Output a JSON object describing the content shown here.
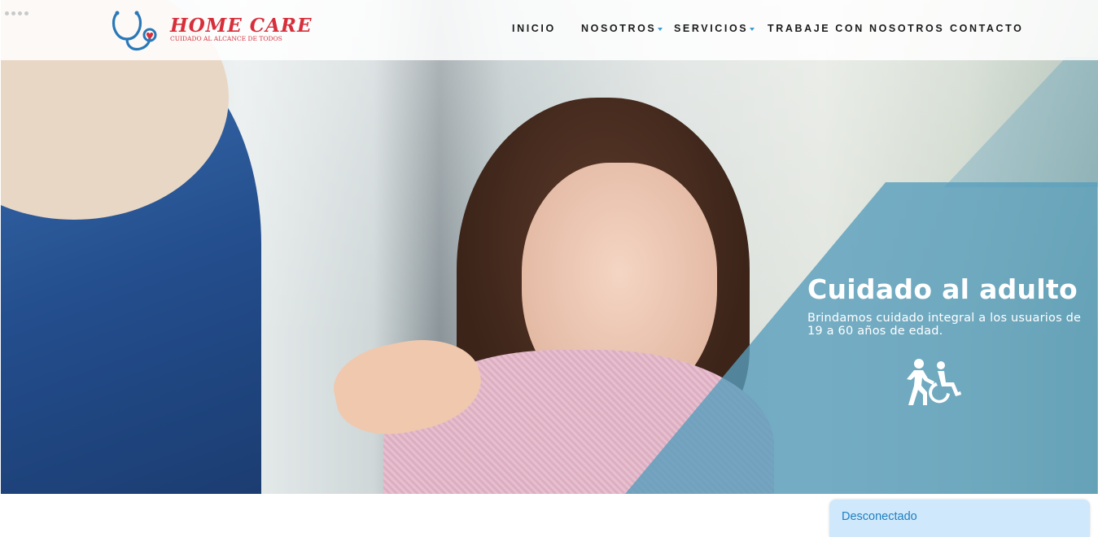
{
  "header": {
    "logo": {
      "title": "HOME CARE",
      "tagline": "CUIDADO AL ALCANCE DE TODOS",
      "icon": "stethoscope-heart-icon"
    },
    "nav": [
      {
        "label": "INICIO",
        "has_dropdown": false
      },
      {
        "label": "NOSOTROS",
        "has_dropdown": true
      },
      {
        "label": "SERVICIOS",
        "has_dropdown": true
      },
      {
        "label": "TRABAJE CON NOSOTROS",
        "has_dropdown": false
      },
      {
        "label": "CONTACTO",
        "has_dropdown": false
      }
    ]
  },
  "slider": {
    "title": "Cuidado al adulto",
    "description": "Brindamos cuidado integral a los usuarios de 19 a 60 años de edad.",
    "icon": "caregiver-wheelchair-icon",
    "dots_count": 4
  },
  "chat_widget": {
    "status": "Desconectado"
  },
  "colors": {
    "brand_red": "#d62f3b",
    "brand_blue": "#2a78b8",
    "overlay_teal": "#589ebc",
    "caret_blue": "#3b9bd1",
    "chat_bg": "#cfe8fb",
    "chat_text": "#1f7fc0"
  }
}
